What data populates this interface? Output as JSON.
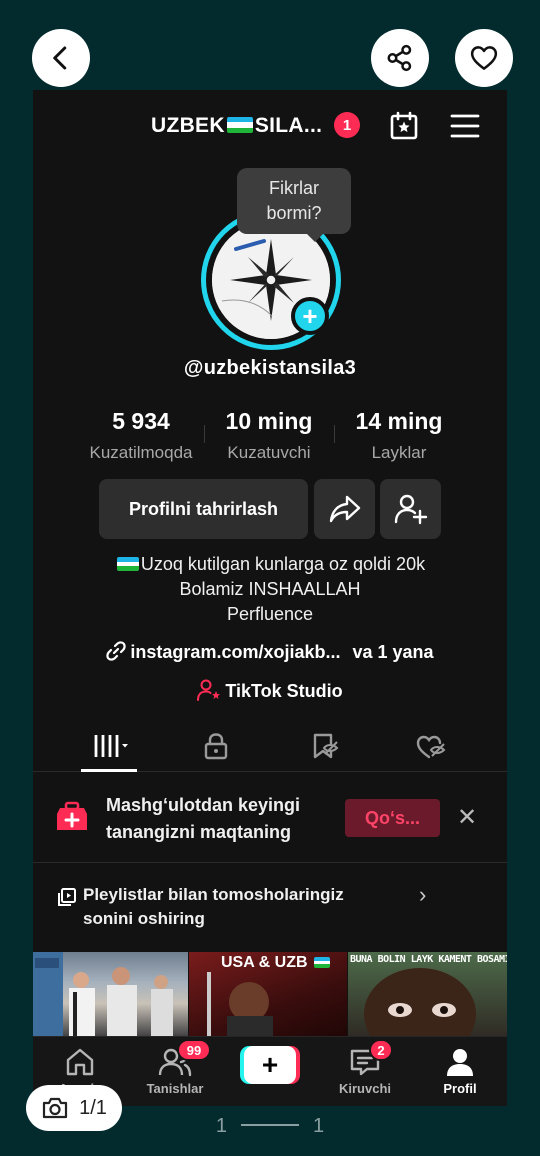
{
  "viewer": {
    "back_icon": "chevron-left-icon",
    "share_icon": "share-icon",
    "like_icon": "heart-icon",
    "counter": "1/1",
    "pager_left": "1",
    "pager_right": "1"
  },
  "header": {
    "title_part1": "UZBEK",
    "title_part2": "SILA...",
    "notification_count": "1"
  },
  "tooltip": {
    "line1": "Fikrlar",
    "line2": "bormi?"
  },
  "profile": {
    "username": "@uzbekistansila3",
    "stats": [
      {
        "value": "5 934",
        "label": "Kuzatilmoqda"
      },
      {
        "value": "10 ming",
        "label": "Kuzatuvchi"
      },
      {
        "value": "14 ming",
        "label": "Layklar"
      }
    ],
    "edit_button": "Profilni tahrirlash",
    "bio_line1": "Uzoq kutilgan kunlarga oz qoldi 20k",
    "bio_line2": "Bolamiz INSHAALLAH",
    "bio_line3": "Perfluence",
    "link": "instagram.com/xojiakb...",
    "link_more": "va 1 yana",
    "studio": "TikTok Studio"
  },
  "promo": {
    "line1": "Mashg‘ulotdan keyingi",
    "line2": "tanangizni maqtaning",
    "button": "Qo‘s..."
  },
  "playlist": {
    "line1": "Pleylistlar bilan tomosholaringiz",
    "line2": "sonini oshiring"
  },
  "thumbnails": [
    {
      "caption": ""
    },
    {
      "caption": "USA & UZB"
    },
    {
      "caption": "BUNA BOLIN LAYK KAMENT BOSAMIZ"
    }
  ],
  "nav": {
    "home": "Asosiy",
    "friends": "Tanishlar",
    "friends_badge": "99",
    "inbox": "Kiruvchi",
    "inbox_badge": "2",
    "profile": "Profil"
  },
  "colors": {
    "accent_red": "#fe2c55",
    "accent_cyan": "#20d5ec",
    "background": "#032b2e",
    "app_background": "#121212"
  }
}
